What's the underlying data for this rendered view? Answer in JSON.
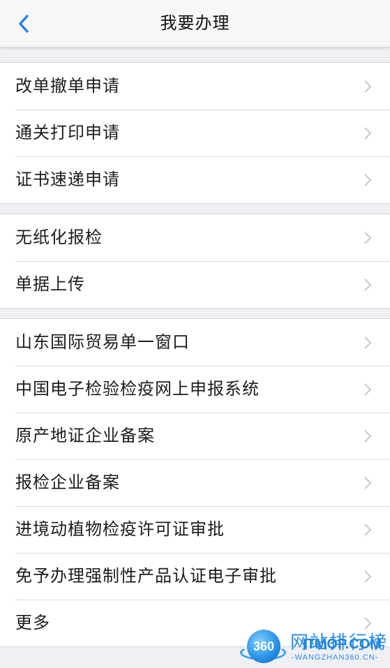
{
  "header": {
    "title": "我要办理",
    "back_icon": "chevron-left-icon"
  },
  "colors": {
    "accent": "#1a7cf5",
    "chevron": "#c7c7cc",
    "background": "#efeff4"
  },
  "groups": [
    {
      "items": [
        {
          "label": "改单撤单申请"
        },
        {
          "label": "通关打印申请"
        },
        {
          "label": "证书速递申请"
        }
      ]
    },
    {
      "items": [
        {
          "label": "无纸化报检"
        },
        {
          "label": "单据上传"
        }
      ]
    },
    {
      "items": [
        {
          "label": "山东国际贸易单一窗口"
        },
        {
          "label": "中国电子检验检疫网上申报系统"
        },
        {
          "label": "原产地证企业备案"
        },
        {
          "label": "报检企业备案"
        },
        {
          "label": "进境动植物检疫许可证审批"
        },
        {
          "label": "免予办理强制性产品认证电子审批"
        },
        {
          "label": "更多"
        }
      ]
    }
  ],
  "watermark": {
    "logo_text": "360",
    "title": "网站排行榜",
    "overlay": "ITMOP.COM",
    "subtitle": "-WANGZHAN360.CN-"
  }
}
